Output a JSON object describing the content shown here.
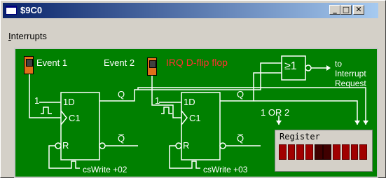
{
  "window": {
    "title": "$9C0"
  },
  "menu": {
    "items": [
      {
        "label": "Interrupts",
        "accel": "I"
      }
    ]
  },
  "diagram": {
    "inputs": [
      {
        "label": "Event 1"
      },
      {
        "label": "Event 2"
      }
    ],
    "title_label": "IRQ D-flip flop",
    "ff_left": {
      "d": "1D",
      "c": "C1",
      "r": "R",
      "q": "Q",
      "qbar": "Q̅",
      "one": "1"
    },
    "ff_right": {
      "d": "1D",
      "c": "C1",
      "r": "R",
      "q": "Q",
      "qbar": "Q̅",
      "one": "1"
    },
    "cswrite_left": "csWrite +02",
    "cswrite_right": "csWrite +03",
    "or_gate": "≥1",
    "or_label": "1 OR 2",
    "output_label": [
      "to",
      "Interrupt",
      "Request"
    ],
    "register": {
      "label": "Register",
      "bits": [
        1,
        1,
        1,
        1,
        0,
        0,
        1,
        1,
        1,
        1
      ]
    }
  },
  "colors": {
    "panel": "#008000",
    "wire": "#ffffff",
    "event": "#e0701a",
    "bit_on": "#a00000",
    "bit_off": "#400000"
  }
}
